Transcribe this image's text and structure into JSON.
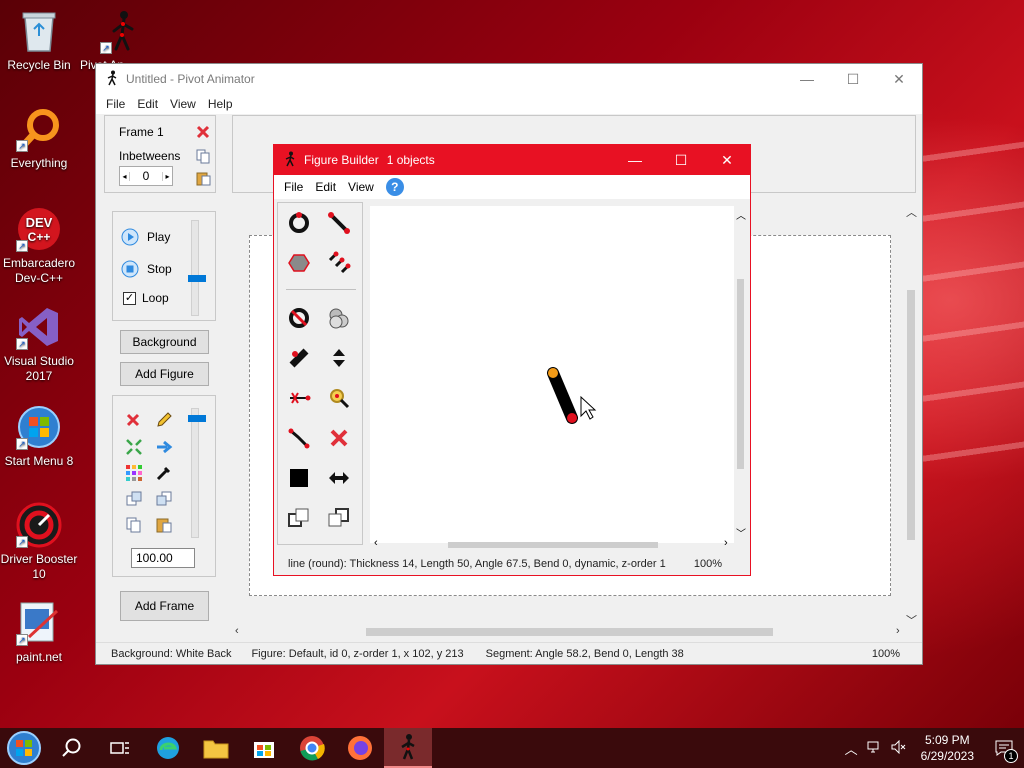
{
  "desktop": {
    "icons": [
      {
        "label": "Recycle Bin"
      },
      {
        "label": "Everything"
      },
      {
        "label": "Embarcadero Dev-C++"
      },
      {
        "label": "Visual Studio 2017"
      },
      {
        "label": "Start Menu 8"
      },
      {
        "label": "Driver Booster 10"
      },
      {
        "label": "paint.net"
      }
    ],
    "partial_icon_label": "Pivot An"
  },
  "main_window": {
    "title": "Untitled - Pivot Animator",
    "controls": {
      "minimize": "—",
      "maximize": "☐",
      "close": "✕"
    },
    "menu": [
      "File",
      "Edit",
      "View",
      "Help"
    ],
    "frame_panel": {
      "frame_label": "Frame 1",
      "inbetweens_label": "Inbetweens",
      "inbetweens_value": "0"
    },
    "playback": {
      "play": "Play",
      "stop": "Stop",
      "loop": "Loop",
      "loop_checked": true
    },
    "buttons": {
      "background": "Background",
      "add_figure": "Add Figure",
      "add_frame": "Add Frame"
    },
    "scale_value": "100.00",
    "status": {
      "background": "Background: White Back",
      "figure": "Figure: Default,  id 0,  z-order 1,  x 102, y 213",
      "segment": "Segment: Angle 58.2,  Bend 0,  Length 38",
      "zoom": "100%"
    }
  },
  "figure_builder": {
    "title": "Figure Builder",
    "object_count": "1 objects",
    "menu": [
      "File",
      "Edit",
      "View"
    ],
    "help_icon": "?",
    "status": "line (round): Thickness 14, Length 50, Angle 67.5, Bend 0, dynamic, z-order 1",
    "zoom": "100%"
  },
  "taskbar": {
    "time": "5:09 PM",
    "date": "6/29/2023",
    "notification_count": "1"
  },
  "colors": {
    "accent_red": "#e81123",
    "joint_orange": "#f29a17",
    "joint_red": "#e0101e"
  }
}
